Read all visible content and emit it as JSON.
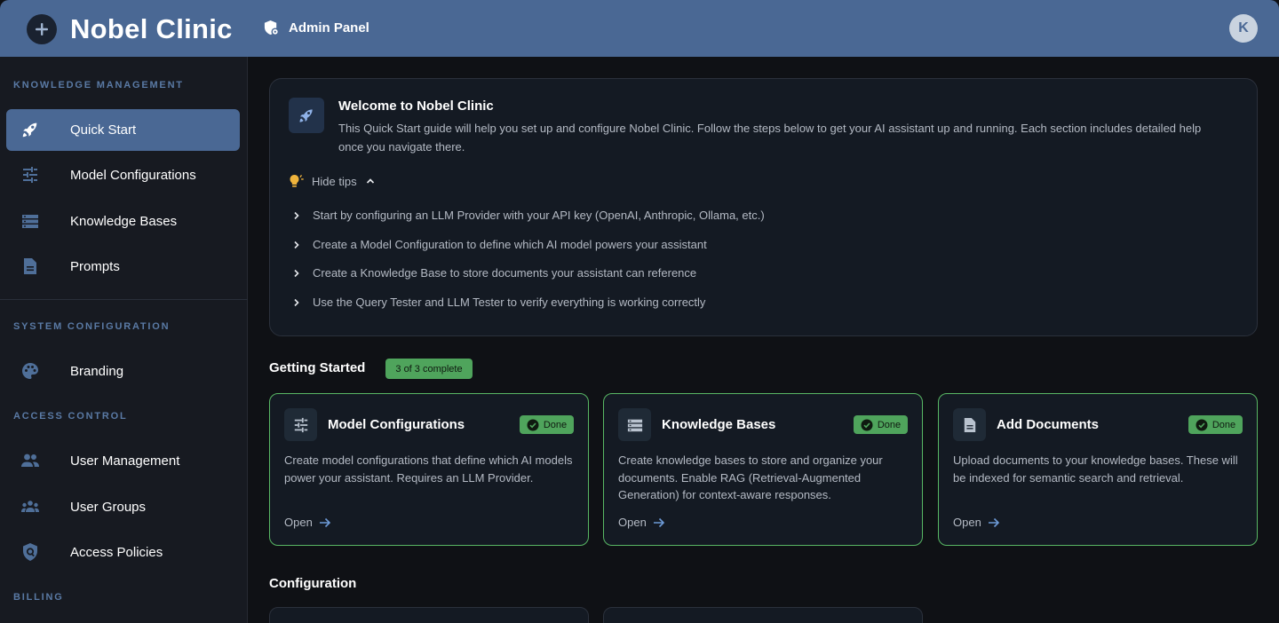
{
  "header": {
    "app_title": "Nobel Clinic",
    "admin_panel_label": "Admin Panel",
    "avatar_initial": "K"
  },
  "sidebar": {
    "sections": {
      "knowledge": "KNOWLEDGE MANAGEMENT",
      "system": "SYSTEM CONFIGURATION",
      "access": "ACCESS CONTROL",
      "billing": "BILLING"
    },
    "items": [
      {
        "label": "Quick Start",
        "icon": "rocket-icon",
        "active": true
      },
      {
        "label": "Model Configurations",
        "icon": "tune-icon"
      },
      {
        "label": "Knowledge Bases",
        "icon": "storage-icon"
      },
      {
        "label": "Prompts",
        "icon": "document-icon"
      },
      {
        "label": "Branding",
        "icon": "palette-icon"
      },
      {
        "label": "User Management",
        "icon": "people-icon"
      },
      {
        "label": "User Groups",
        "icon": "groups-icon"
      },
      {
        "label": "Access Policies",
        "icon": "shield-icon"
      }
    ]
  },
  "welcome": {
    "title": "Welcome to Nobel Clinic",
    "description": "This Quick Start guide will help you set up and configure Nobel Clinic. Follow the steps below to get your AI assistant up and running. Each section includes detailed help once you navigate there.",
    "hide_tips_label": "Hide tips",
    "tips": [
      "Start by configuring an LLM Provider with your API key (OpenAI, Anthropic, Ollama, etc.)",
      "Create a Model Configuration to define which AI model powers your assistant",
      "Create a Knowledge Base to store documents your assistant can reference",
      "Use the Query Tester and LLM Tester to verify everything is working correctly"
    ]
  },
  "getting_started": {
    "title": "Getting Started",
    "badge": "3 of 3 complete",
    "cards": [
      {
        "title": "Model Configurations",
        "status": "Done",
        "icon": "tune-icon",
        "description": "Create model configurations that define which AI models power your assistant. Requires an LLM Provider.",
        "link": "Open"
      },
      {
        "title": "Knowledge Bases",
        "status": "Done",
        "icon": "storage-icon",
        "description": "Create knowledge bases to store and organize your documents. Enable RAG (Retrieval-Augmented Generation) for context-aware responses.",
        "link": "Open"
      },
      {
        "title": "Add Documents",
        "status": "Done",
        "icon": "document-icon",
        "description": "Upload documents to your knowledge bases. These will be indexed for semantic search and retrieval.",
        "link": "Open"
      }
    ]
  },
  "configuration": {
    "title": "Configuration"
  },
  "colors": {
    "header": "#4a6894",
    "sidebar": "#171a21",
    "background": "#0f1115",
    "success": "#4fa45c",
    "section_title": "#5a7aa5"
  }
}
